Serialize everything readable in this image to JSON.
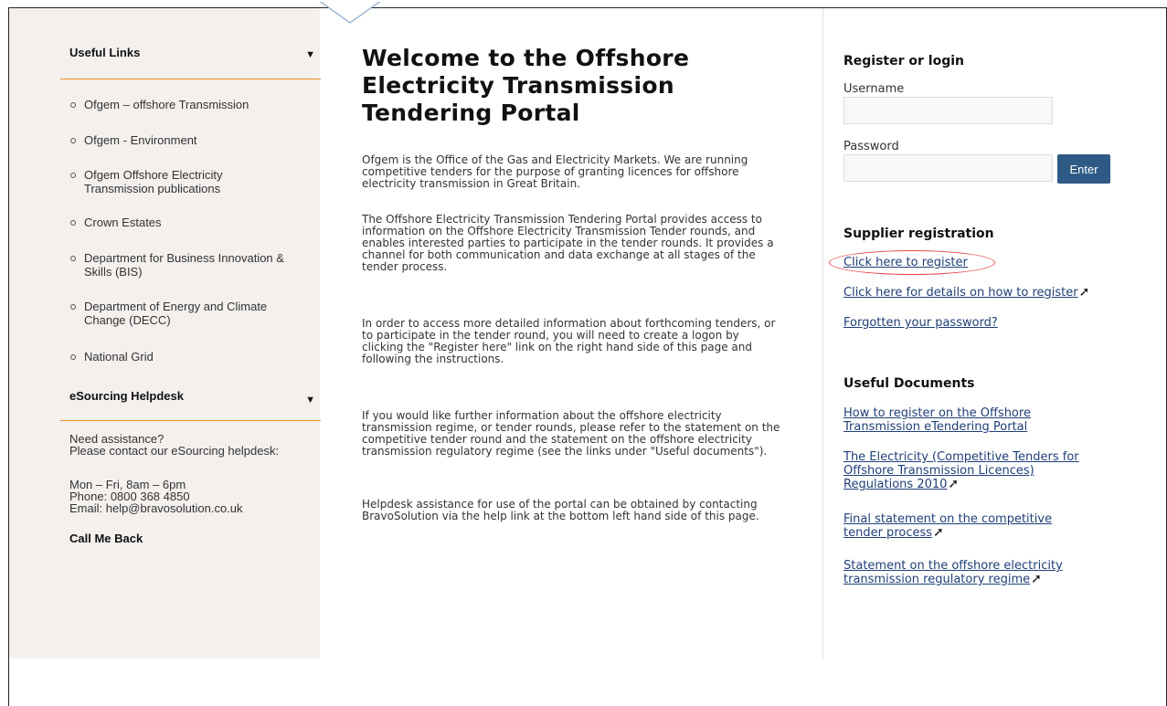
{
  "sidebar": {
    "useful_links_heading": "Useful Links",
    "links": [
      "Ofgem – offshore Transmission",
      "Ofgem - Environment",
      "Ofgem Offshore Electricity",
      "Transmission publications",
      "Crown Estates",
      "Department for Business Innovation &",
      "Skills (BIS)",
      "Department of Energy and Climate",
      "Change (DECC)",
      "National Grid"
    ],
    "helpdesk_heading": "eSourcing Helpdesk",
    "help_lines": [
      "Need assistance?",
      "Please contact our eSourcing helpdesk:",
      "Mon – Fri, 8am – 6pm",
      "Phone: 0800 368 4850",
      "Email: help@bravosolution.co.uk"
    ],
    "call_me_back": "Call Me Back",
    "arrow_glyph": "▼"
  },
  "main": {
    "title": "Welcome to the Offshore Electricity Transmission Tendering Portal",
    "paragraphs": [
      "Ofgem is the Office of the Gas and Electricity Markets. We are running competitive tenders for the purpose of granting licences for offshore electricity transmission in Great Britain.",
      "The Offshore Electricity Transmission Tendering Portal provides access to information on the Offshore Electricity Transmission Tender rounds, and enables interested parties to participate in the tender rounds. It provides a channel for both communication and data exchange at all stages of the tender process.",
      "In order to access more detailed information about forthcoming tenders, or to participate in the tender round, you will need to create a logon by clicking the \"Register here\" link on the right hand side of this page and following the instructions.",
      "If you would like further information about the offshore electricity transmission regime, or tender rounds, please refer to the statement on the competitive tender round and the statement on the offshore electricity transmission regulatory regime (see the links under \"Useful documents\").",
      "Helpdesk assistance for use of the portal can be obtained by contacting BravoSolution via the help link at the bottom left hand side of this page."
    ]
  },
  "login": {
    "heading": "Register or login",
    "username_label": "Username",
    "password_label": "Password",
    "enter_label": "Enter"
  },
  "supplier": {
    "heading": "Supplier registration",
    "register_link": "Click here to register",
    "details_link": "Click here for details on how to register",
    "forgot_link": "Forgotten your password?"
  },
  "documents": {
    "heading": "Useful Documents",
    "doc1": [
      "How to register on the Offshore",
      "Transmission eTendering Portal"
    ],
    "doc2": [
      "The Electricity (Competitive Tenders for",
      "Offshore Transmission Licences)",
      "Regulations 2010"
    ],
    "doc3": [
      "Final statement on the competitive",
      "tender process"
    ],
    "doc4": [
      "Statement on the offshore electricity",
      "transmission regulatory regime"
    ]
  },
  "icons": {
    "external_link": "➚"
  },
  "colors": {
    "accent_orange": "#e8912c",
    "link_blue": "#1f3f77",
    "button_blue": "#2f5a85",
    "highlight_red": "#e84a4a"
  }
}
